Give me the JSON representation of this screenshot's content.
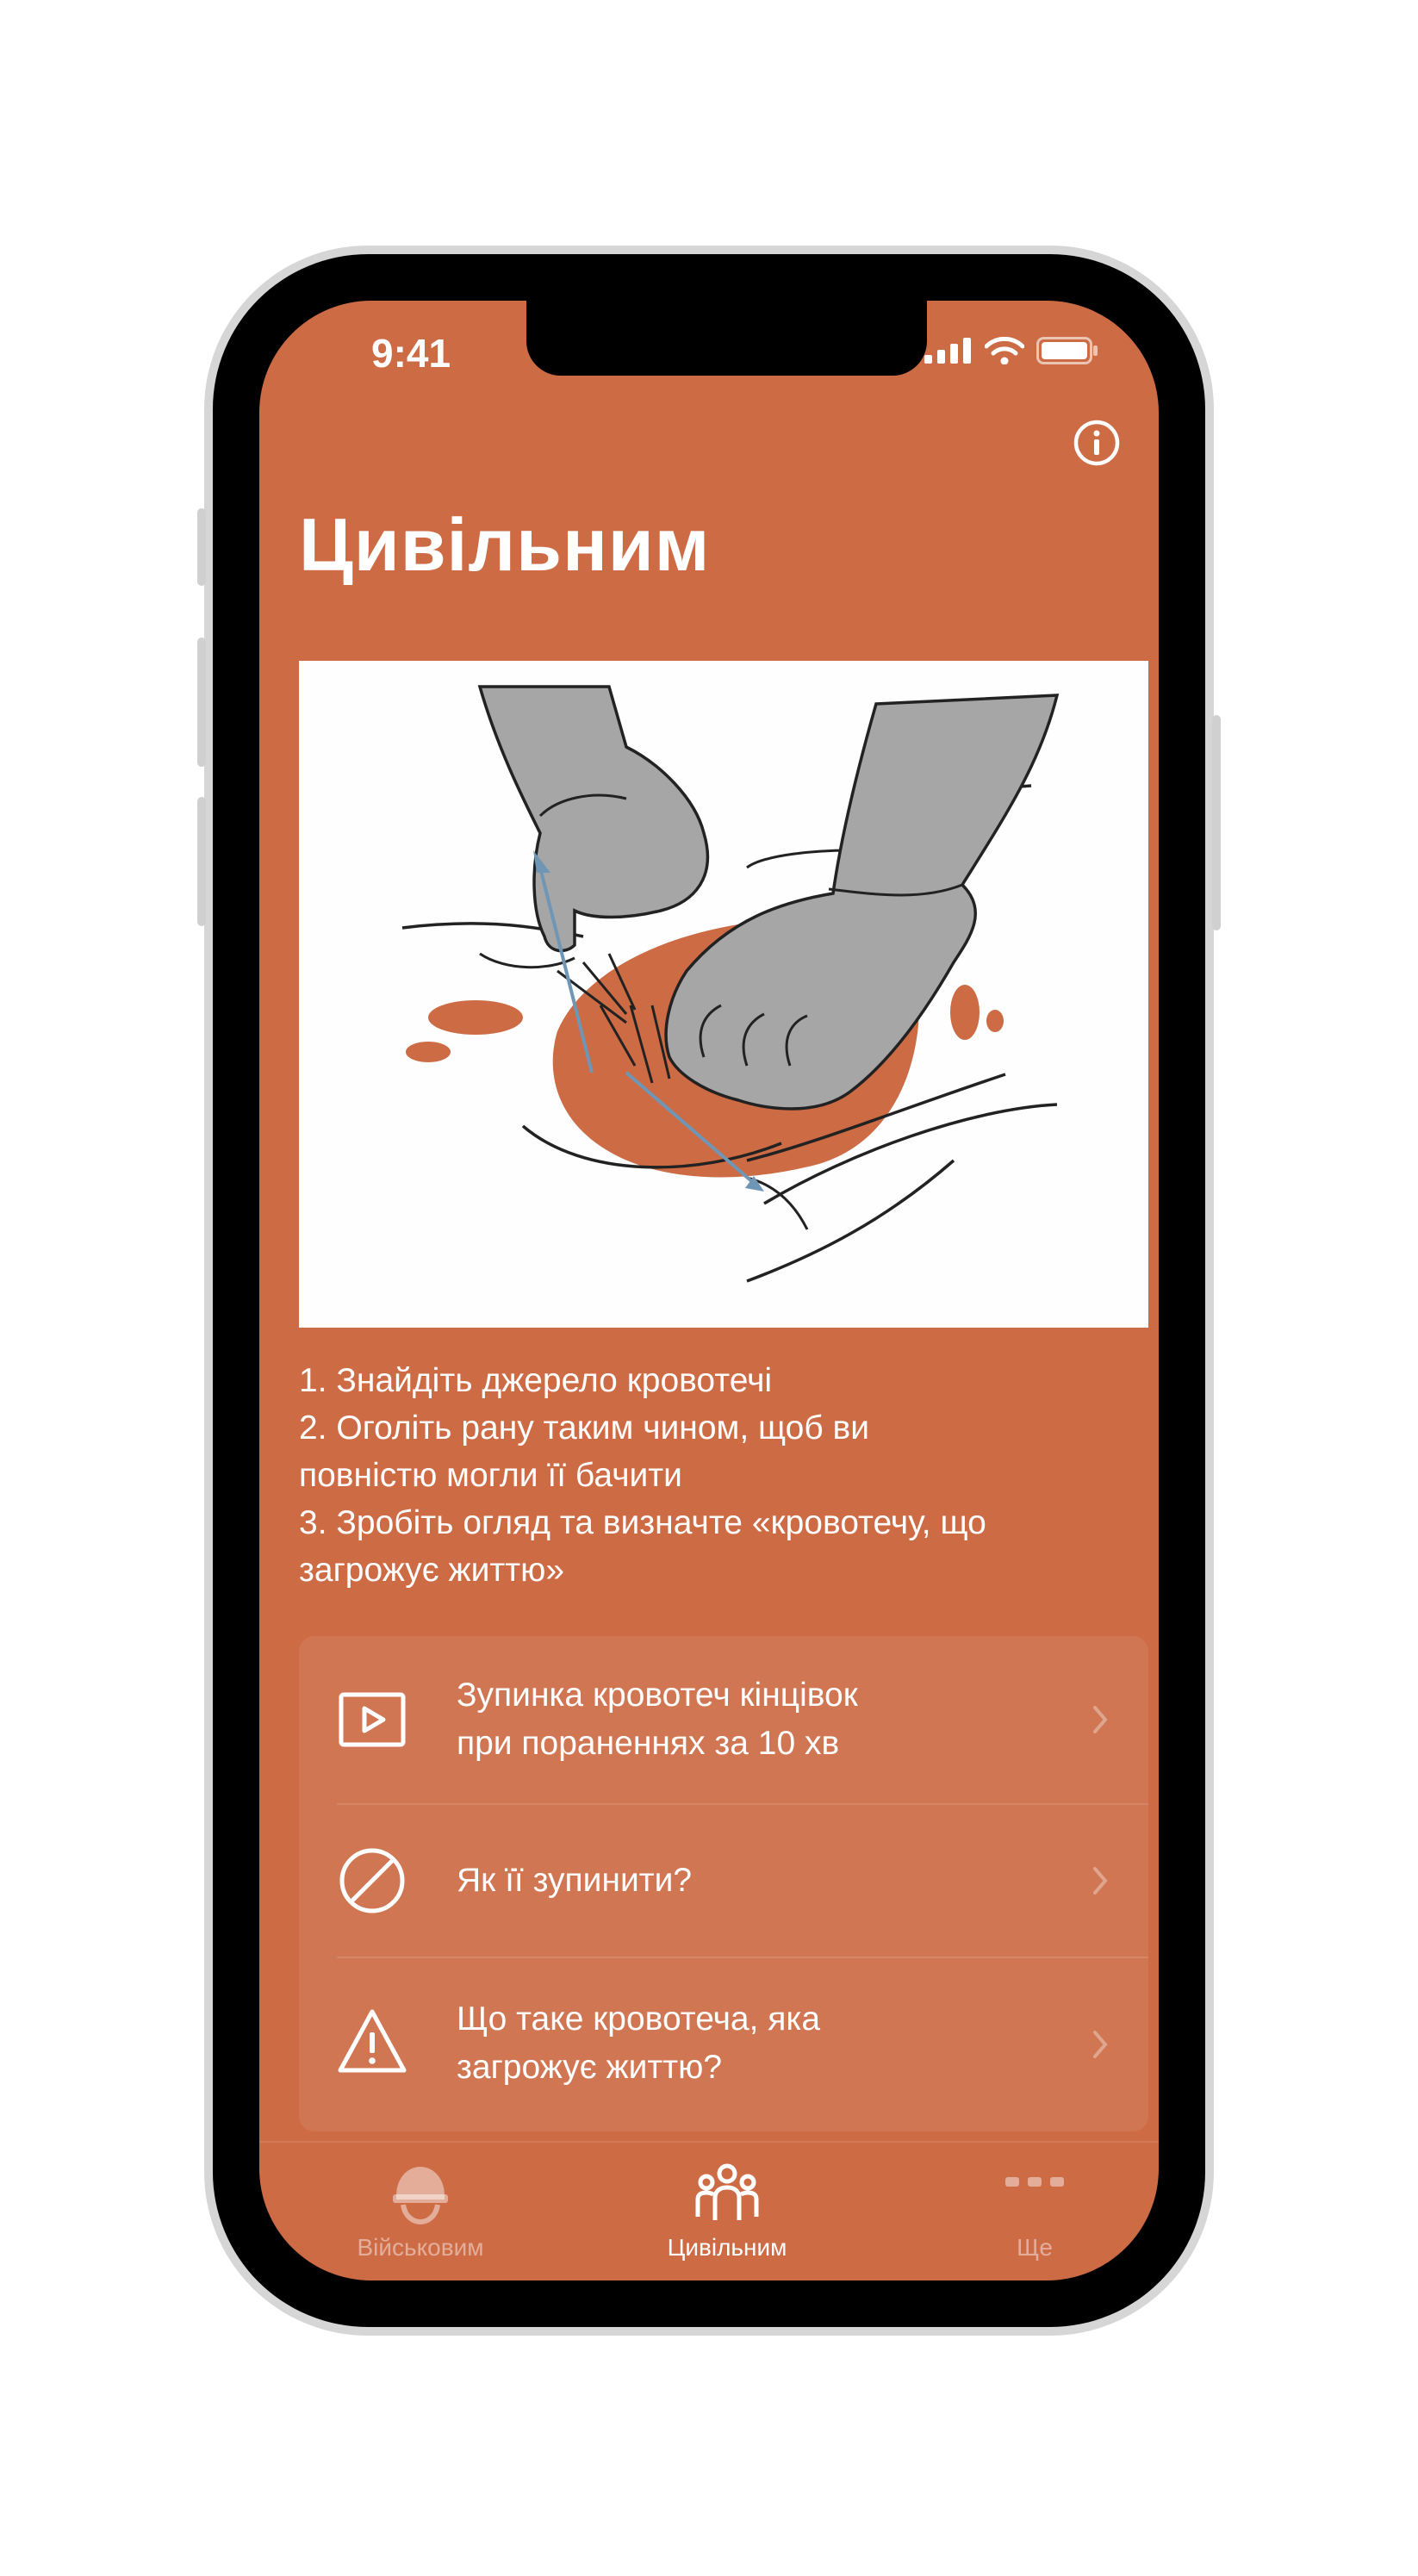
{
  "status_bar": {
    "time": "9:41"
  },
  "header": {
    "title": "Цивільним"
  },
  "illustration": {
    "description_name": "bleeding-wound-illustration"
  },
  "instructions": [
    "1. Знайдіть джерело кровотечі",
    "2. Оголіть рану таким чином, щоб ви\nповністю могли її бачити",
    "3. Зробіть огляд та визначте «кровотечу, що\nзагрожує життю»"
  ],
  "menu": [
    {
      "label": "Зупинка кровотеч кінцівок\nпри пораненнях за 10 хв",
      "icon": "video-play-icon"
    },
    {
      "label": "Як її зупинити?",
      "icon": "prohibited-icon"
    },
    {
      "label": "Що таке кровотеча, яка\nзагрожує життю?",
      "icon": "warning-icon"
    }
  ],
  "tabs": [
    {
      "label": "Військовим",
      "icon": "helmet-icon",
      "active": false
    },
    {
      "label": "Цивільним",
      "icon": "people-group-icon",
      "active": true
    },
    {
      "label": "Ще",
      "icon": "more-dots-icon",
      "active": false
    }
  ],
  "colors": {
    "accent": "#cd6b45",
    "glove": "#a6a6a6",
    "arrow": "#6f96b5"
  }
}
